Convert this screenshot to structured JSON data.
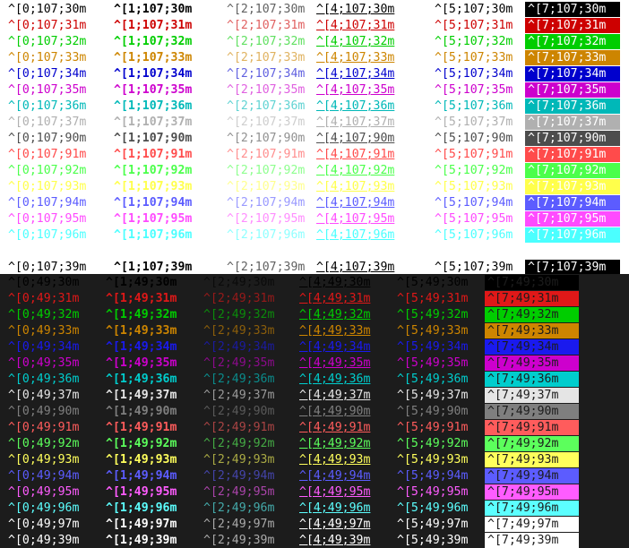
{
  "sections": [
    {
      "name": "bg107",
      "bg_code": "107",
      "background": "#ffffff",
      "default_fg": "#000000",
      "rows": [
        {
          "fg": "30",
          "color": "#000000",
          "labels": [
            "^[0;107;30m",
            "^[1;107;30m",
            "^[2;107;30m",
            "^[4;107;30m",
            "^[5;107;30m",
            "^[7;107;30m"
          ]
        },
        {
          "fg": "31",
          "color": "#cd0000",
          "labels": [
            "^[0;107;31m",
            "^[1;107;31m",
            "^[2;107;31m",
            "^[4;107;31m",
            "^[5;107;31m",
            "^[7;107;31m"
          ]
        },
        {
          "fg": "32",
          "color": "#00cd00",
          "labels": [
            "^[0;107;32m",
            "^[1;107;32m",
            "^[2;107;32m",
            "^[4;107;32m",
            "^[5;107;32m",
            "^[7;107;32m"
          ]
        },
        {
          "fg": "33",
          "color": "#cd8500",
          "labels": [
            "^[0;107;33m",
            "^[1;107;33m",
            "^[2;107;33m",
            "^[4;107;33m",
            "^[5;107;33m",
            "^[7;107;33m"
          ]
        },
        {
          "fg": "34",
          "color": "#0000cd",
          "labels": [
            "^[0;107;34m",
            "^[1;107;34m",
            "^[2;107;34m",
            "^[4;107;34m",
            "^[5;107;34m",
            "^[7;107;34m"
          ]
        },
        {
          "fg": "35",
          "color": "#cd00cd",
          "labels": [
            "^[0;107;35m",
            "^[1;107;35m",
            "^[2;107;35m",
            "^[4;107;35m",
            "^[5;107;35m",
            "^[7;107;35m"
          ]
        },
        {
          "fg": "36",
          "color": "#00b8b8",
          "labels": [
            "^[0;107;36m",
            "^[1;107;36m",
            "^[2;107;36m",
            "^[4;107;36m",
            "^[5;107;36m",
            "^[7;107;36m"
          ]
        },
        {
          "fg": "37",
          "color": "#b0b0b0",
          "labels": [
            "^[0;107;37m",
            "^[1;107;37m",
            "^[2;107;37m",
            "^[4;107;37m",
            "^[5;107;37m",
            "^[7;107;37m"
          ]
        },
        {
          "fg": "90",
          "color": "#4d4d4d",
          "labels": [
            "^[0;107;90m",
            "^[1;107;90m",
            "^[2;107;90m",
            "^[4;107;90m",
            "^[5;107;90m",
            "^[7;107;90m"
          ]
        },
        {
          "fg": "91",
          "color": "#ff4b4b",
          "labels": [
            "^[0;107;91m",
            "^[1;107;91m",
            "^[2;107;91m",
            "^[4;107;91m",
            "^[5;107;91m",
            "^[7;107;91m"
          ]
        },
        {
          "fg": "92",
          "color": "#4bff4b",
          "labels": [
            "^[0;107;92m",
            "^[1;107;92m",
            "^[2;107;92m",
            "^[4;107;92m",
            "^[5;107;92m",
            "^[7;107;92m"
          ]
        },
        {
          "fg": "93",
          "color": "#ffff4b",
          "labels": [
            "^[0;107;93m",
            "^[1;107;93m",
            "^[2;107;93m",
            "^[4;107;93m",
            "^[5;107;93m",
            "^[7;107;93m"
          ]
        },
        {
          "fg": "94",
          "color": "#5c5cff",
          "labels": [
            "^[0;107;94m",
            "^[1;107;94m",
            "^[2;107;94m",
            "^[4;107;94m",
            "^[5;107;94m",
            "^[7;107;94m"
          ]
        },
        {
          "fg": "95",
          "color": "#ff4bff",
          "labels": [
            "^[0;107;95m",
            "^[1;107;95m",
            "^[2;107;95m",
            "^[4;107;95m",
            "^[5;107;95m",
            "^[7;107;95m"
          ]
        },
        {
          "fg": "96",
          "color": "#4bffff",
          "labels": [
            "^[0;107;96m",
            "^[1;107;96m",
            "^[2;107;96m",
            "^[4;107;96m",
            "^[5;107;96m",
            "^[7;107;96m"
          ]
        },
        {
          "fg": "97",
          "color": "#ffffff",
          "labels": [
            "^[0;107;97m",
            "^[1;107;97m",
            "^[2;107;97m",
            "^[4;107;97m",
            "^[5;107;97m",
            "^[7;107;97m"
          ]
        },
        {
          "fg": "39",
          "color": "#000000",
          "labels": [
            "^[0;107;39m",
            "^[1;107;39m",
            "^[2;107;39m",
            "^[4;107;39m",
            "^[5;107;39m",
            "^[7;107;39m"
          ]
        }
      ]
    },
    {
      "name": "bg49",
      "bg_code": "49",
      "background": "#1c1c1c",
      "default_fg": "#ffffff",
      "rows": [
        {
          "fg": "30",
          "color": "#000000",
          "labels": [
            "^[0;49;30m",
            "^[1;49;30m",
            "^[2;49;30m",
            "^[4;49;30m",
            "^[5;49;30m",
            "^[7;49;30m"
          ]
        },
        {
          "fg": "31",
          "color": "#e01818",
          "labels": [
            "^[0;49;31m",
            "^[1;49;31m",
            "^[2;49;31m",
            "^[4;49;31m",
            "^[5;49;31m",
            "^[7;49;31m"
          ]
        },
        {
          "fg": "32",
          "color": "#00cd00",
          "labels": [
            "^[0;49;32m",
            "^[1;49;32m",
            "^[2;49;32m",
            "^[4;49;32m",
            "^[5;49;32m",
            "^[7;49;32m"
          ]
        },
        {
          "fg": "33",
          "color": "#cd8500",
          "labels": [
            "^[0;49;33m",
            "^[1;49;33m",
            "^[2;49;33m",
            "^[4;49;33m",
            "^[5;49;33m",
            "^[7;49;33m"
          ]
        },
        {
          "fg": "34",
          "color": "#1a1aee",
          "labels": [
            "^[0;49;34m",
            "^[1;49;34m",
            "^[2;49;34m",
            "^[4;49;34m",
            "^[5;49;34m",
            "^[7;49;34m"
          ]
        },
        {
          "fg": "35",
          "color": "#cd00cd",
          "labels": [
            "^[0;49;35m",
            "^[1;49;35m",
            "^[2;49;35m",
            "^[4;49;35m",
            "^[5;49;35m",
            "^[7;49;35m"
          ]
        },
        {
          "fg": "36",
          "color": "#00cdcd",
          "labels": [
            "^[0;49;36m",
            "^[1;49;36m",
            "^[2;49;36m",
            "^[4;49;36m",
            "^[5;49;36m",
            "^[7;49;36m"
          ]
        },
        {
          "fg": "37",
          "color": "#e5e5e5",
          "labels": [
            "^[0;49;37m",
            "^[1;49;37m",
            "^[2;49;37m",
            "^[4;49;37m",
            "^[5;49;37m",
            "^[7;49;37m"
          ]
        },
        {
          "fg": "90",
          "color": "#7f7f7f",
          "labels": [
            "^[0;49;90m",
            "^[1;49;90m",
            "^[2;49;90m",
            "^[4;49;90m",
            "^[5;49;90m",
            "^[7;49;90m"
          ]
        },
        {
          "fg": "91",
          "color": "#ff5c5c",
          "labels": [
            "^[0;49;91m",
            "^[1;49;91m",
            "^[2;49;91m",
            "^[4;49;91m",
            "^[5;49;91m",
            "^[7;49;91m"
          ]
        },
        {
          "fg": "92",
          "color": "#5cff5c",
          "labels": [
            "^[0;49;92m",
            "^[1;49;92m",
            "^[2;49;92m",
            "^[4;49;92m",
            "^[5;49;92m",
            "^[7;49;92m"
          ]
        },
        {
          "fg": "93",
          "color": "#ffff5c",
          "labels": [
            "^[0;49;93m",
            "^[1;49;93m",
            "^[2;49;93m",
            "^[4;49;93m",
            "^[5;49;93m",
            "^[7;49;93m"
          ]
        },
        {
          "fg": "94",
          "color": "#5c5cff",
          "labels": [
            "^[0;49;94m",
            "^[1;49;94m",
            "^[2;49;94m",
            "^[4;49;94m",
            "^[5;49;94m",
            "^[7;49;94m"
          ]
        },
        {
          "fg": "95",
          "color": "#ff5cff",
          "labels": [
            "^[0;49;95m",
            "^[1;49;95m",
            "^[2;49;95m",
            "^[4;49;95m",
            "^[5;49;95m",
            "^[7;49;95m"
          ]
        },
        {
          "fg": "96",
          "color": "#5cffff",
          "labels": [
            "^[0;49;96m",
            "^[1;49;96m",
            "^[2;49;96m",
            "^[4;49;96m",
            "^[5;49;96m",
            "^[7;49;96m"
          ]
        },
        {
          "fg": "97",
          "color": "#ffffff",
          "labels": [
            "^[0;49;97m",
            "^[1;49;97m",
            "^[2;49;97m",
            "^[4;49;97m",
            "^[5;49;97m",
            "^[7;49;97m"
          ]
        },
        {
          "fg": "39",
          "color": "#ffffff",
          "labels": [
            "^[0;49;39m",
            "^[1;49;39m",
            "^[2;49;39m",
            "^[4;49;39m",
            "^[5;49;39m",
            "^[7;49;39m"
          ]
        }
      ]
    }
  ]
}
